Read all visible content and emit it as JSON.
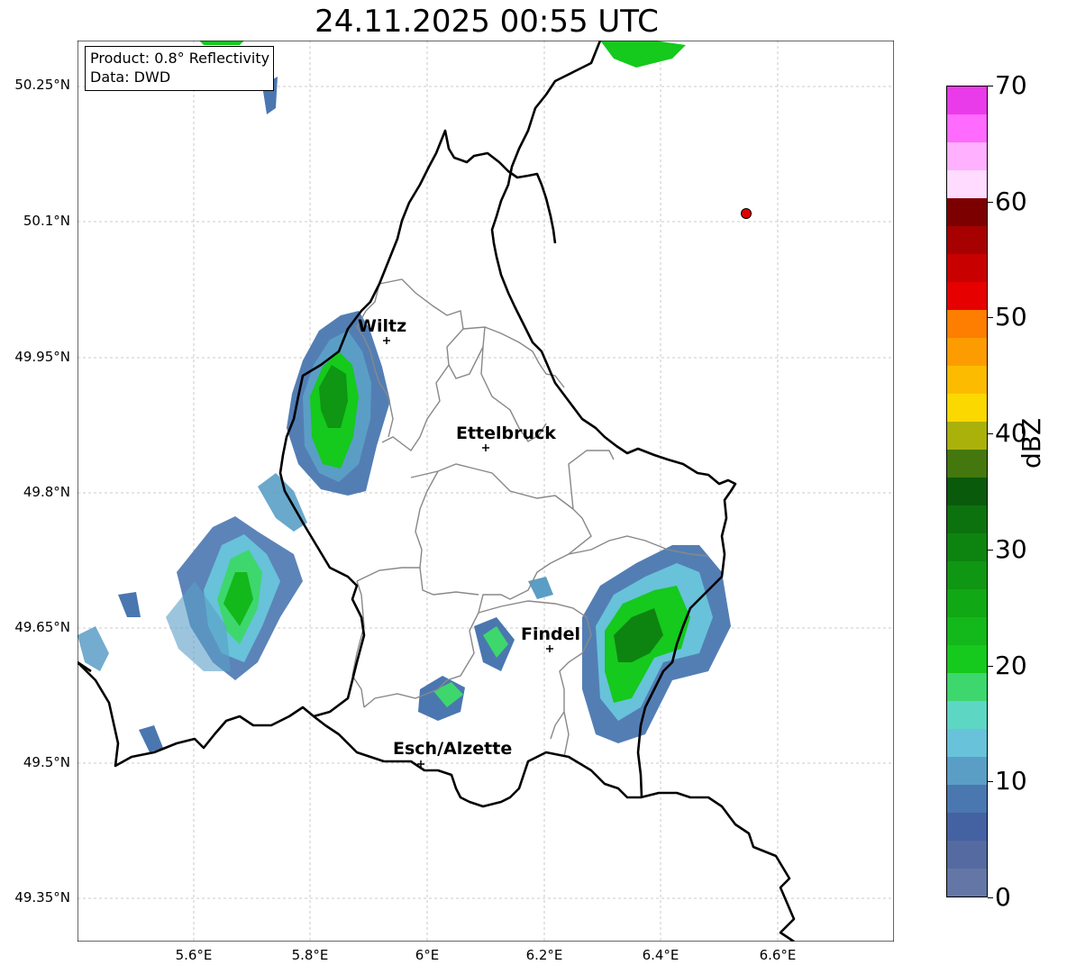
{
  "title": "24.11.2025 00:55 UTC",
  "info_box": {
    "product": "Product: 0.8° Reflectivity",
    "data": "Data: DWD"
  },
  "axes": {
    "lat_ticks": [
      "50.25°N",
      "50.1°N",
      "49.95°N",
      "49.8°N",
      "49.65°N",
      "49.5°N",
      "49.35°N"
    ],
    "lon_ticks": [
      "5.6°E",
      "5.8°E",
      "6°E",
      "6.2°E",
      "6.4°E",
      "6.6°E"
    ],
    "grid": "on"
  },
  "cities": [
    {
      "name": "Wiltz",
      "lon": 5.93,
      "lat": 49.967
    },
    {
      "name": "Ettelbruck",
      "lon": 6.1,
      "lat": 49.85
    },
    {
      "name": "Findel",
      "lon": 6.21,
      "lat": 49.627
    },
    {
      "name": "Esch/Alzette",
      "lon": 5.99,
      "lat": 49.5
    }
  ],
  "radar_site_marker": {
    "color": "#e00000"
  },
  "colorbar": {
    "label": "dBZ",
    "ticks": [
      "0",
      "10",
      "20",
      "30",
      "40",
      "50",
      "60",
      "70"
    ],
    "colors": [
      "#6476a6",
      "#546aa0",
      "#4461a2",
      "#4a77b0",
      "#5a9ec6",
      "#68c2da",
      "#5dd6c4",
      "#3dd76e",
      "#15c91d",
      "#13b81a",
      "#10a814",
      "#0f9612",
      "#0e8410",
      "#0c720e",
      "#0a5a0c",
      "#44780e",
      "#aab10b",
      "#fbd800",
      "#fdbb00",
      "#fd9c00",
      "#fd7e00",
      "#e60000",
      "#c80000",
      "#a60000",
      "#7c0000",
      "#ffdcff",
      "#ffb0ff",
      "#ff6aff",
      "#ea3bea"
    ]
  }
}
